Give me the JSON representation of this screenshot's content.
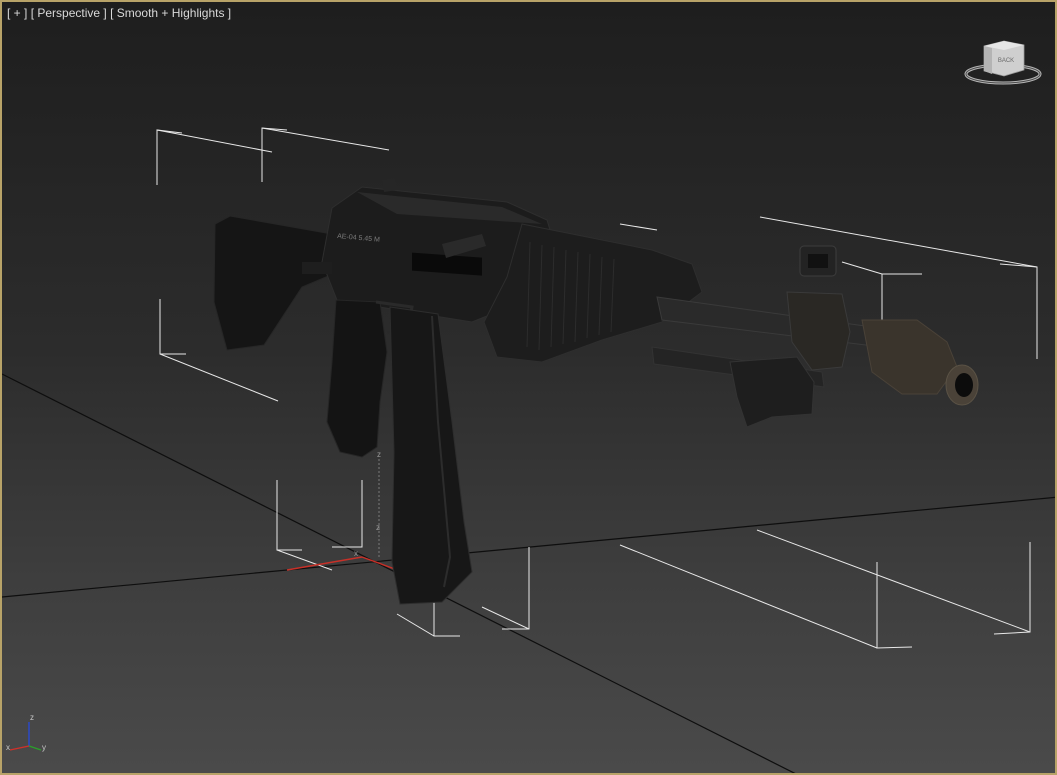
{
  "viewport": {
    "menu_plus": "[ + ]",
    "view_mode": "[ Perspective ]",
    "shading_mode": "[ Smooth + Highlights ]",
    "border_color": "#b8a368",
    "background_top": "#1e1e1e",
    "background_bottom": "#4a4a4a"
  },
  "viewcube": {
    "face_label": "BACK",
    "icon": "viewcube-icon"
  },
  "model": {
    "stamp_text": "АЕ-04 5.45 М",
    "icon": "rifle-model"
  },
  "gizmo": {
    "axis_x": "x",
    "axis_y": "y",
    "axis_z": "z",
    "x_color": "#d0302a",
    "y_color": "#2aa02a",
    "z_color": "#2a4ad0"
  },
  "world_axis": {
    "axis_x": "x",
    "axis_y": "y",
    "axis_z": "z"
  }
}
